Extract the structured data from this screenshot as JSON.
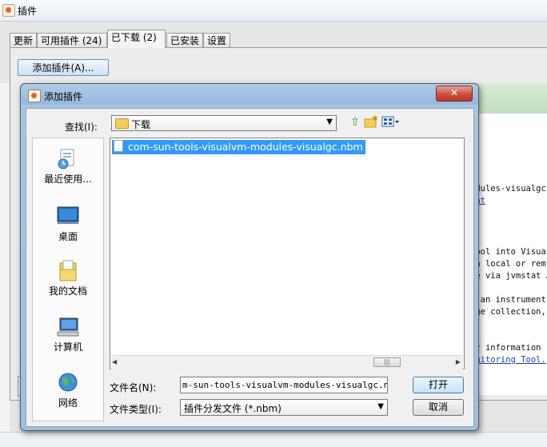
{
  "window": {
    "title": "插件"
  },
  "tabs": [
    {
      "label": "更新",
      "active": false
    },
    {
      "label": "可用插件 (24)",
      "active": false
    },
    {
      "label": "已下载 (2)",
      "active": true
    },
    {
      "label": "已安装",
      "active": false
    },
    {
      "label": "设置",
      "active": false
    }
  ],
  "toolbar": {
    "add_plugin_label": "添加插件(A)..."
  },
  "background_details": {
    "lines": [
      "odules-visualgc.",
      "tat",
      "tool into Visua",
      "th local or rem",
      "ve via jvmstat A",
      "o an instrument",
      "age collection,",
      "or information",
      "onitoring Tool."
    ]
  },
  "dialog": {
    "title": "添加插件",
    "close_label": "✕",
    "look_in": {
      "label": "查找(I):",
      "value": "下载"
    },
    "places": [
      {
        "label": "最近使用...",
        "icon": "recent-places-icon"
      },
      {
        "label": "桌面",
        "icon": "desktop-icon"
      },
      {
        "label": "我的文档",
        "icon": "documents-icon"
      },
      {
        "label": "计算机",
        "icon": "computer-icon"
      },
      {
        "label": "网络",
        "icon": "network-icon"
      }
    ],
    "files": [
      {
        "name": "com-sun-tools-visualvm-modules-visualgc.nbm",
        "selected": true
      }
    ],
    "file_name": {
      "label": "文件名(N):",
      "value": "m-sun-tools-visualvm-modules-visualgc.nbm\""
    },
    "file_type": {
      "label": "文件类型(I):",
      "value": "插件分发文件 (*.nbm)"
    },
    "buttons": {
      "open": "打开",
      "cancel": "取消"
    }
  },
  "colors": {
    "selection": "#3399ff",
    "dialog_frame": "#9fc0e0",
    "close_button": "#c94f40"
  }
}
